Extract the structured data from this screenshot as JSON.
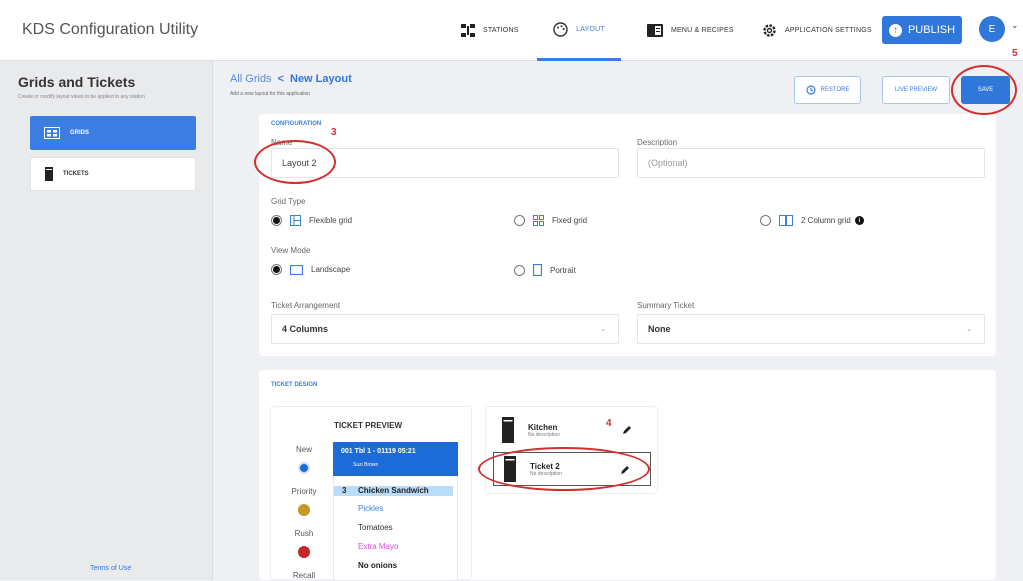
{
  "app": {
    "title": "KDS Configuration Utility"
  },
  "nav": {
    "stations": "STATIONS",
    "layout": "LAYOUT",
    "menu_recipes": "MENU & RECIPES",
    "app_settings": "APPLICATION SETTINGS",
    "publish": "PUBLISH",
    "avatar": "E"
  },
  "sidebar": {
    "title": "Grids and Tickets",
    "subtitle": "Create or modify layout views to be applied to any station",
    "items": [
      {
        "label": "GRIDS"
      },
      {
        "label": "TICKETS"
      }
    ],
    "terms": "Terms of Use"
  },
  "header": {
    "all_grids": "All Grids",
    "separator": "<",
    "current": "New Layout",
    "subtitle": "Add a new layout for this application",
    "restore": "RESTORE",
    "live_preview": "LIVE PREVIEW",
    "save": "SAVE"
  },
  "config": {
    "section": "CONFIGURATION",
    "name_label": "Name",
    "name_value": "Layout 2",
    "description_label": "Description",
    "description_placeholder": "(Optional)",
    "grid_type_label": "Grid Type",
    "grid_options": [
      "Flexible grid",
      "Fixed grid",
      "2 Column grid"
    ],
    "grid_selected": "Flexible grid",
    "view_mode_label": "View Mode",
    "view_options": [
      "Landscape",
      "Portrait"
    ],
    "view_selected": "Landscape",
    "arrangement_label": "Ticket Arrangement",
    "arrangement_value": "4 Columns",
    "summary_label": "Summary Ticket",
    "summary_value": "None"
  },
  "design": {
    "section": "TICKET DESIGN",
    "preview_title": "TICKET PREVIEW",
    "legend": [
      {
        "label": "New",
        "color": "#1d6bd6"
      },
      {
        "label": "Priority",
        "color": "#c9962a"
      },
      {
        "label": "Rush",
        "color": "#c62828"
      },
      {
        "label": "Recall",
        "color": "#555555"
      }
    ],
    "ticket_header_line1": "001   Tbl 1 - 01119   05:21",
    "ticket_header_line2": "Suzi Brown",
    "ticket_lines": [
      {
        "qty": "3",
        "text": "Chicken Sandwich"
      },
      {
        "text": "Pickles"
      },
      {
        "text": "Tomatoes"
      },
      {
        "text": "Extra Mayo"
      },
      {
        "text": "No onions"
      }
    ],
    "templates": [
      {
        "name": "Kitchen",
        "desc": "No description"
      },
      {
        "name": "Ticket 2",
        "desc": "No description"
      }
    ]
  },
  "annotations": [
    "3",
    "4",
    "5"
  ]
}
